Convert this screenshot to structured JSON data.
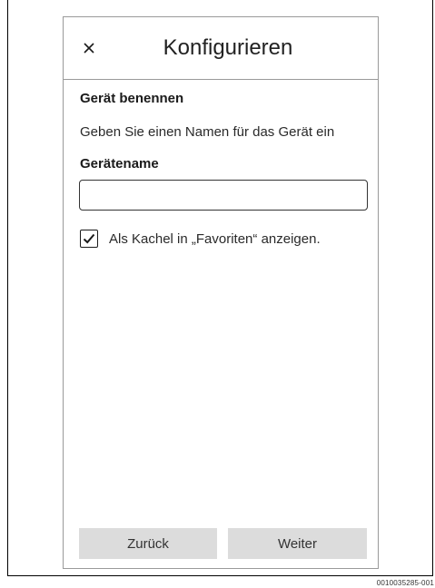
{
  "header": {
    "title": "Konfigurieren",
    "close_icon": "close-icon"
  },
  "content": {
    "section_heading": "Gerät benennen",
    "section_description": "Geben Sie einen Namen für das Gerät ein",
    "field_label": "Gerätename",
    "field_value": "",
    "field_placeholder": "",
    "favorites_checkbox": {
      "checked": true,
      "label": "Als Kachel in „Favoriten“ anzeigen."
    }
  },
  "footer": {
    "back_label": "Zurück",
    "next_label": "Weiter"
  },
  "figure_id": "0010035285-001"
}
